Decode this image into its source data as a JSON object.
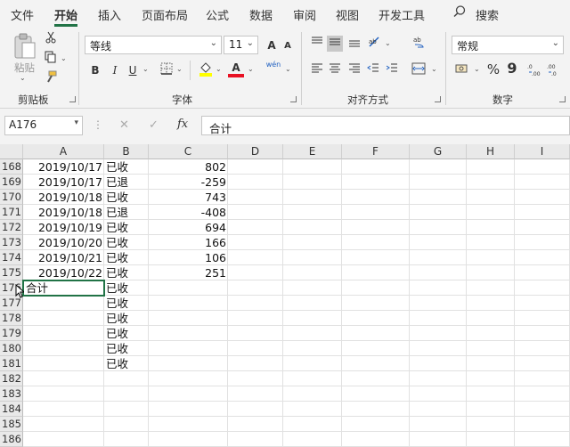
{
  "menu": {
    "tabs": [
      "文件",
      "开始",
      "插入",
      "页面布局",
      "公式",
      "数据",
      "审阅",
      "视图",
      "开发工具"
    ],
    "active_index": 1,
    "search_label": "搜索"
  },
  "ribbon": {
    "clipboard": {
      "paste_label": "粘贴",
      "group_label": "剪贴板"
    },
    "font": {
      "font_name": "等线",
      "font_size": "11",
      "bold": "B",
      "italic": "I",
      "underline": "U",
      "increase": "A",
      "decrease": "A",
      "font_color_glyph": "A",
      "phonetic": "wén",
      "group_label": "字体"
    },
    "alignment": {
      "group_label": "对齐方式"
    },
    "number": {
      "format": "常规",
      "percent": "%",
      "comma": "9",
      "group_label": "数字"
    }
  },
  "formula_bar": {
    "name_box": "A176",
    "cancel": "✕",
    "enter": "✓",
    "fx": "fx",
    "content": "合计"
  },
  "sheet": {
    "columns": [
      "A",
      "B",
      "C",
      "D",
      "E",
      "F",
      "G",
      "H",
      "I"
    ],
    "rows": [
      {
        "num": "168",
        "a": "2019/10/17",
        "b": "已收",
        "c": "802"
      },
      {
        "num": "169",
        "a": "2019/10/17",
        "b": "已退",
        "c": "-259"
      },
      {
        "num": "170",
        "a": "2019/10/18",
        "b": "已收",
        "c": "743"
      },
      {
        "num": "171",
        "a": "2019/10/18",
        "b": "已退",
        "c": "-408"
      },
      {
        "num": "172",
        "a": "2019/10/19",
        "b": "已收",
        "c": "694"
      },
      {
        "num": "173",
        "a": "2019/10/20",
        "b": "已收",
        "c": "166"
      },
      {
        "num": "174",
        "a": "2019/10/21",
        "b": "已收",
        "c": "106"
      },
      {
        "num": "175",
        "a": "2019/10/22",
        "b": "已收",
        "c": "251"
      },
      {
        "num": "176",
        "a": "合计",
        "b": "已收",
        "c": ""
      },
      {
        "num": "177",
        "a": "",
        "b": "已收",
        "c": ""
      },
      {
        "num": "178",
        "a": "",
        "b": "已收",
        "c": ""
      },
      {
        "num": "179",
        "a": "",
        "b": "已收",
        "c": ""
      },
      {
        "num": "180",
        "a": "",
        "b": "已收",
        "c": ""
      },
      {
        "num": "181",
        "a": "",
        "b": "已收",
        "c": ""
      },
      {
        "num": "182",
        "a": "",
        "b": "",
        "c": ""
      },
      {
        "num": "183",
        "a": "",
        "b": "",
        "c": ""
      },
      {
        "num": "184",
        "a": "",
        "b": "",
        "c": ""
      },
      {
        "num": "185",
        "a": "",
        "b": "",
        "c": ""
      },
      {
        "num": "186",
        "a": "",
        "b": "",
        "c": ""
      }
    ]
  },
  "colors": {
    "accent": "#217346",
    "font_color_bar": "#e81123",
    "fill_color_bar": "#ffff00"
  }
}
